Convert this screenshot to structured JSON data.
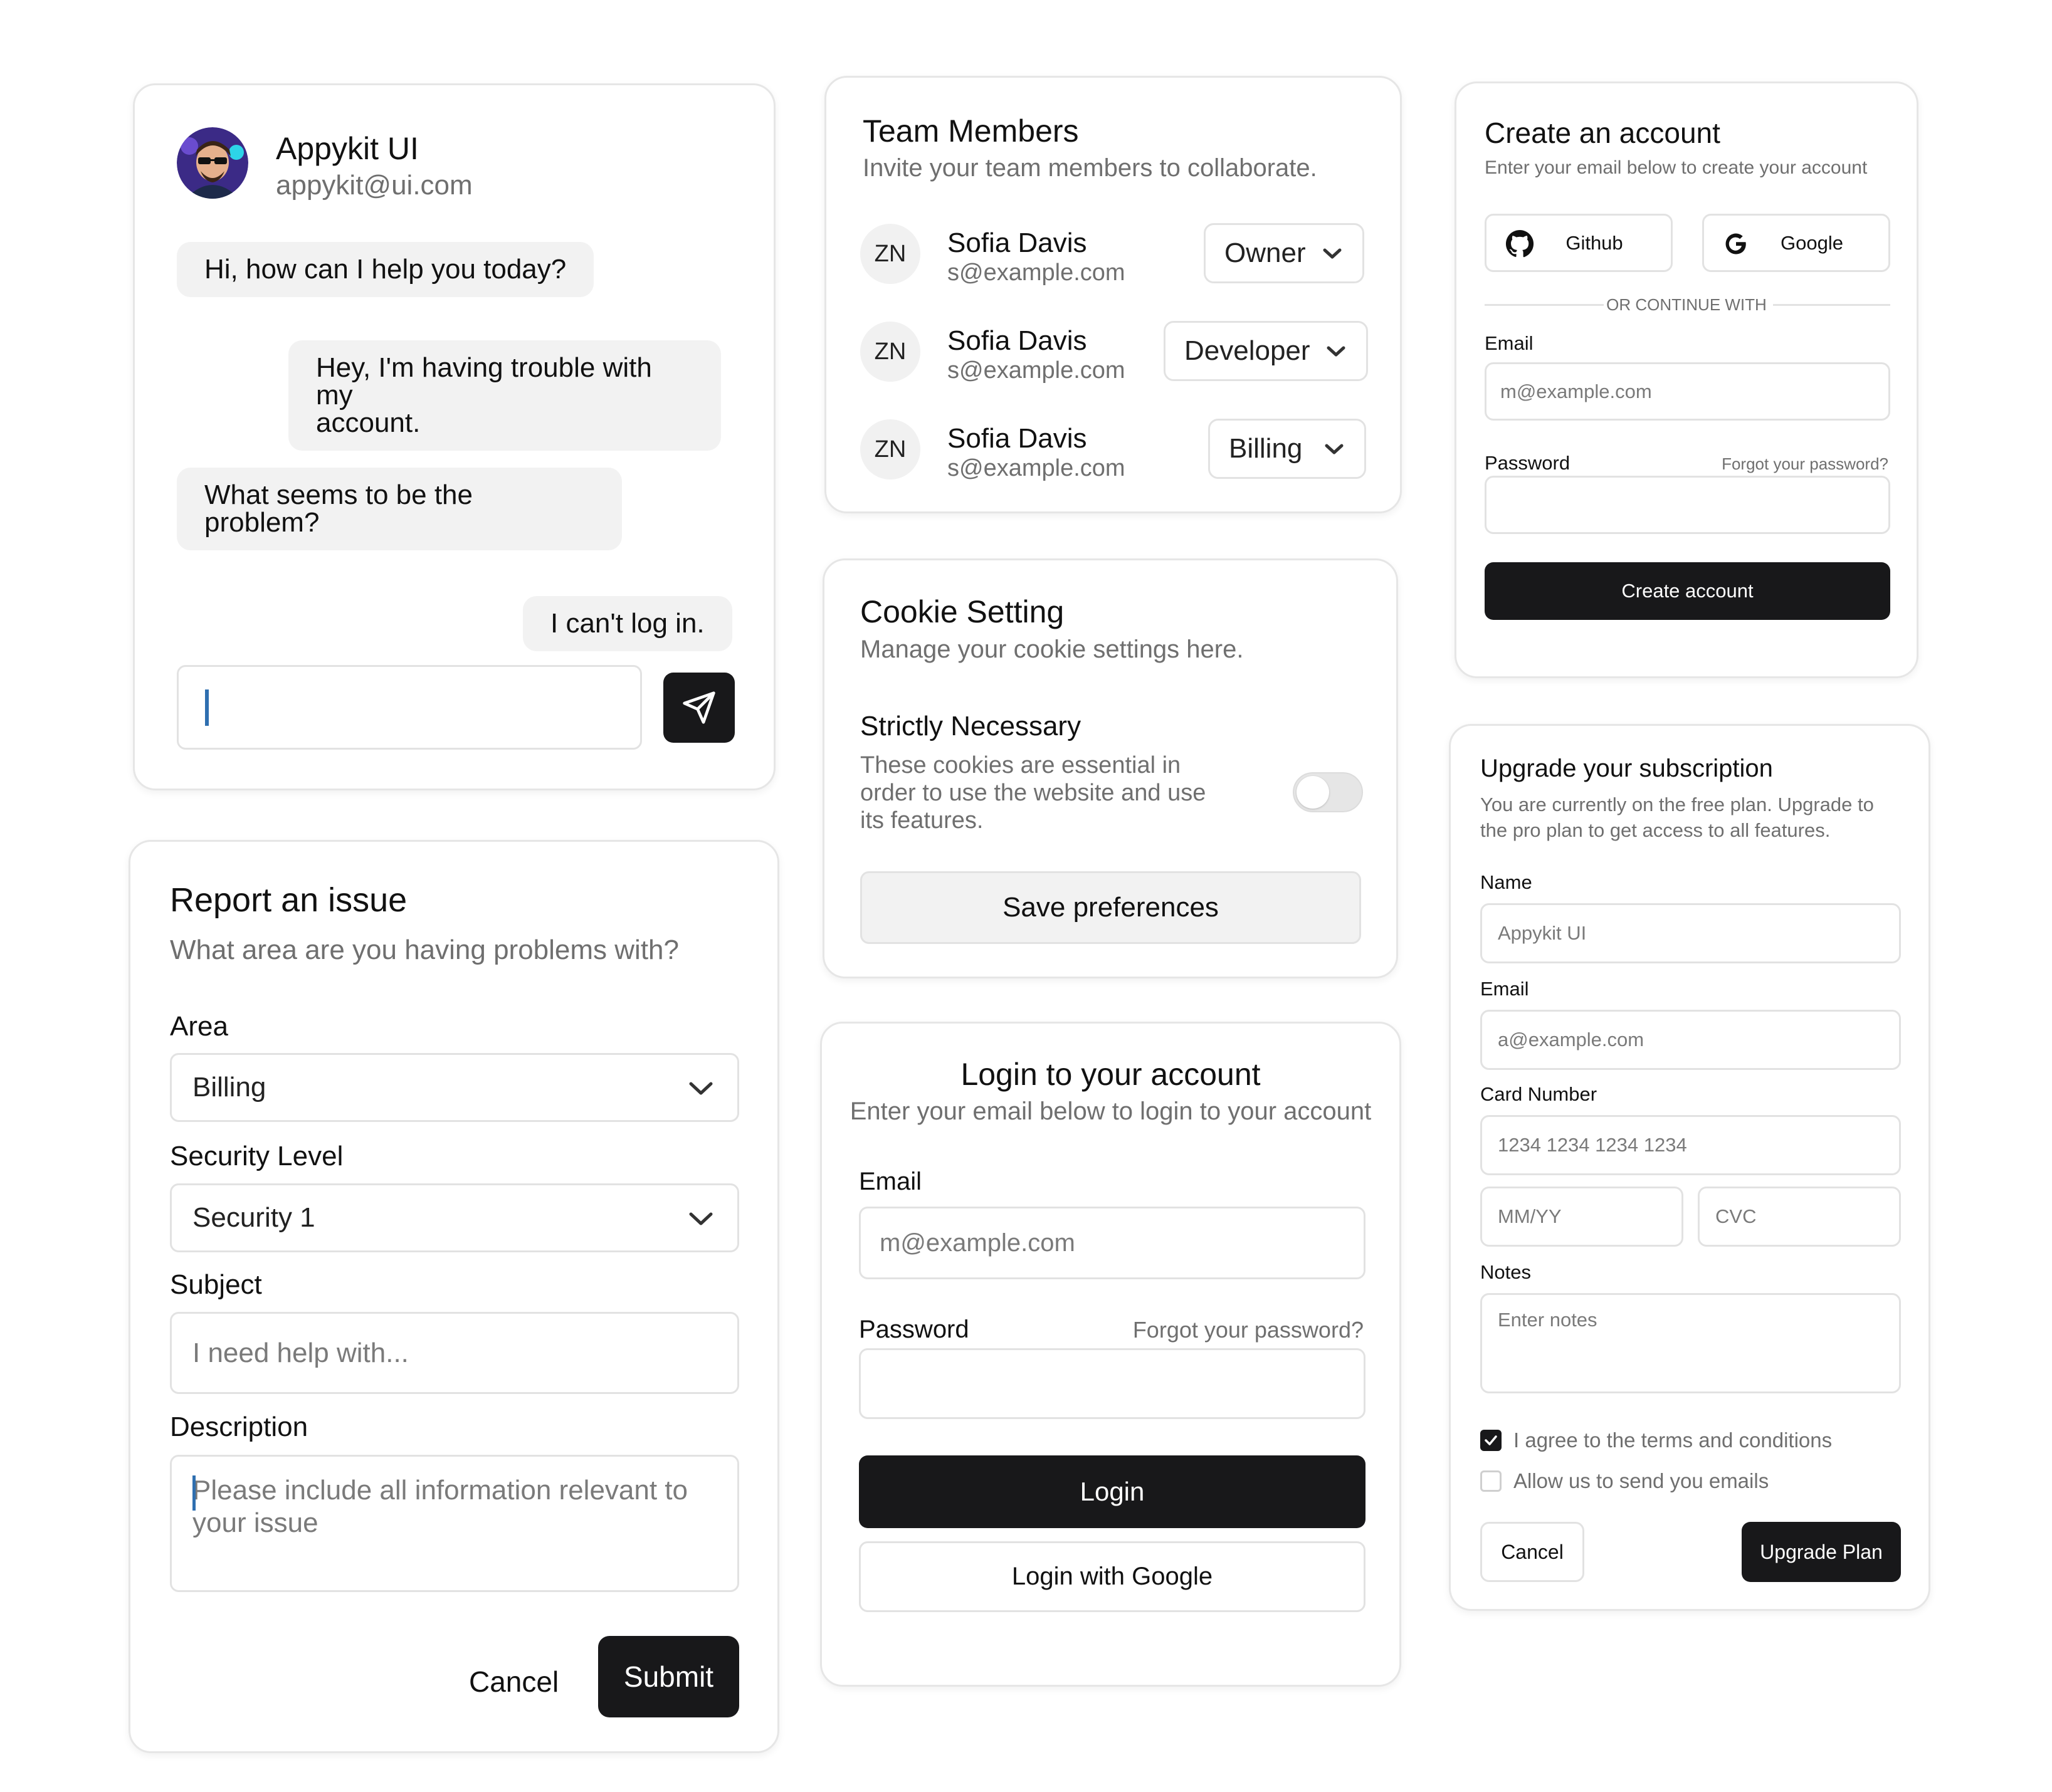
{
  "chat": {
    "name": "Appykit UI",
    "email": "appykit@ui.com",
    "messages": [
      {
        "from": "agent",
        "text": "Hi, how can I help you today?"
      },
      {
        "from": "user",
        "line1": "Hey, I'm having trouble with my",
        "line2": "account."
      },
      {
        "from": "agent",
        "line1": "What seems to be the",
        "line2": "problem?"
      },
      {
        "from": "user",
        "text": "I can't log in."
      }
    ],
    "input_value": ""
  },
  "report": {
    "title": "Report an issue",
    "subtitle": "What area are you having problems with?",
    "area_label": "Area",
    "area_value": "Billing",
    "security_label": "Security Level",
    "security_value": "Security 1",
    "subject_label": "Subject",
    "subject_placeholder": "I need help with...",
    "description_label": "Description",
    "description_line1": "Please include all information relevant to",
    "description_line2": "your issue",
    "cancel": "Cancel",
    "submit": "Submit"
  },
  "team": {
    "title": "Team Members",
    "subtitle": "Invite your team members to collaborate.",
    "members": [
      {
        "initials": "ZN",
        "name": "Sofia Davis",
        "email": "s@example.com",
        "role": "Owner"
      },
      {
        "initials": "ZN",
        "name": "Sofia Davis",
        "email": "s@example.com",
        "role": "Developer"
      },
      {
        "initials": "ZN",
        "name": "Sofia Davis",
        "email": "s@example.com",
        "role": "Billing"
      }
    ]
  },
  "cookie": {
    "title": "Cookie Setting",
    "subtitle": "Manage your cookie settings here.",
    "section_title": "Strictly Necessary",
    "line1": "These cookies are essential in",
    "line2": "order to use the website and use",
    "line3": "its features.",
    "toggle_on": false,
    "save": "Save preferences"
  },
  "login": {
    "title": "Login to your account",
    "subtitle": "Enter your email below to login to your account",
    "email_label": "Email",
    "email_placeholder": "m@example.com",
    "password_label": "Password",
    "forgot": "Forgot your password?",
    "login": "Login",
    "google": "Login with Google"
  },
  "create": {
    "title": "Create an account",
    "subtitle": "Enter your email below to create your account",
    "github": "Github",
    "google": "Google",
    "divider": "OR CONTINUE WITH",
    "email_label": "Email",
    "email_placeholder": "m@example.com",
    "password_label": "Password",
    "forgot": "Forgot your password?",
    "button": "Create account"
  },
  "upgrade": {
    "title": "Upgrade your subscription",
    "line1": "You are currently on the free plan. Upgrade to",
    "line2": "the pro plan to get access to all features.",
    "name_label": "Name",
    "name_placeholder": "Appykit UI",
    "email_label": "Email",
    "email_placeholder": "a@example.com",
    "card_label": "Card Number",
    "card_placeholder": "1234 1234 1234 1234",
    "mmyy_placeholder": "MM/YY",
    "cvc_placeholder": "CVC",
    "notes_label": "Notes",
    "notes_placeholder": "Enter notes",
    "terms": "I agree to the terms and conditions",
    "terms_checked": true,
    "emails": "Allow us to send you emails",
    "emails_checked": false,
    "cancel": "Cancel",
    "upgrade": "Upgrade Plan"
  },
  "colors": {
    "dark": "#18181a",
    "border": "#e2e2e2",
    "muted": "#6f6f6f",
    "bubble": "#f2f2f2",
    "caret": "#2f6fb0"
  },
  "icons": [
    "avatar-illustration",
    "send-icon",
    "chevron-down-icon",
    "github-icon",
    "google-icon",
    "checkbox-checked-icon"
  ]
}
